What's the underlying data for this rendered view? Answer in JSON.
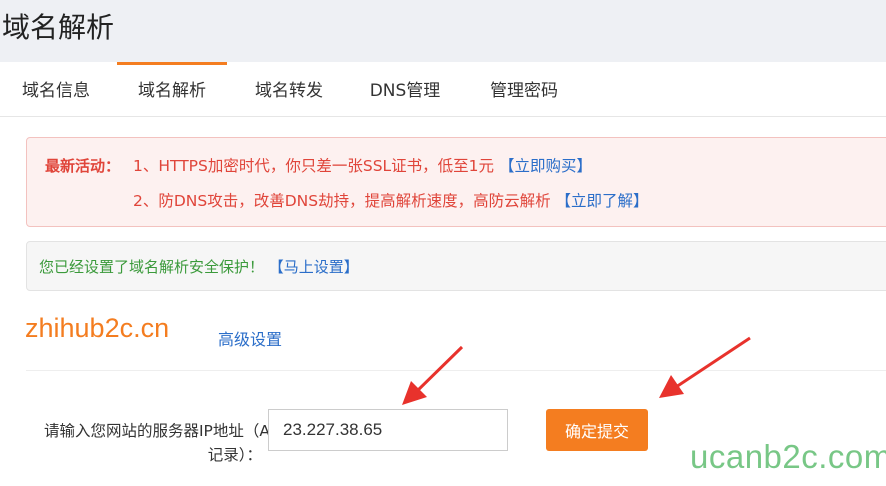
{
  "page": {
    "title": "域名解析"
  },
  "tabs": [
    {
      "label": "域名信息",
      "active": false
    },
    {
      "label": "域名解析",
      "active": true
    },
    {
      "label": "域名转发",
      "active": false
    },
    {
      "label": "DNS管理",
      "active": false
    },
    {
      "label": "管理密码",
      "active": false
    }
  ],
  "promo": {
    "label": "最新活动：",
    "line1_text": "1、HTTPS加密时代，你只差一张SSL证书，低至1元",
    "line1_link": "【立即购买】",
    "line2_text": "2、防DNS攻击，改善DNS劫持，提高解析速度，高防云解析",
    "line2_link": "【立即了解】"
  },
  "security": {
    "text": "您已经设置了域名解析安全保护！",
    "link": "【马上设置】"
  },
  "domain": {
    "name": "zhihub2c.cn",
    "advanced_link": "高级设置"
  },
  "form": {
    "ip_label_line1": "请输入您网站的服务器IP地址（A",
    "ip_label_line2": "记录）：",
    "ip_value": "23.227.38.65",
    "submit_label": "确定提交"
  },
  "watermark": "ucanb2c.com",
  "colors": {
    "accent": "#f47d20",
    "link": "#2b6ec9",
    "promo_text": "#e0453a",
    "success_text": "#3b9a3b",
    "arrow": "#e8322c"
  }
}
